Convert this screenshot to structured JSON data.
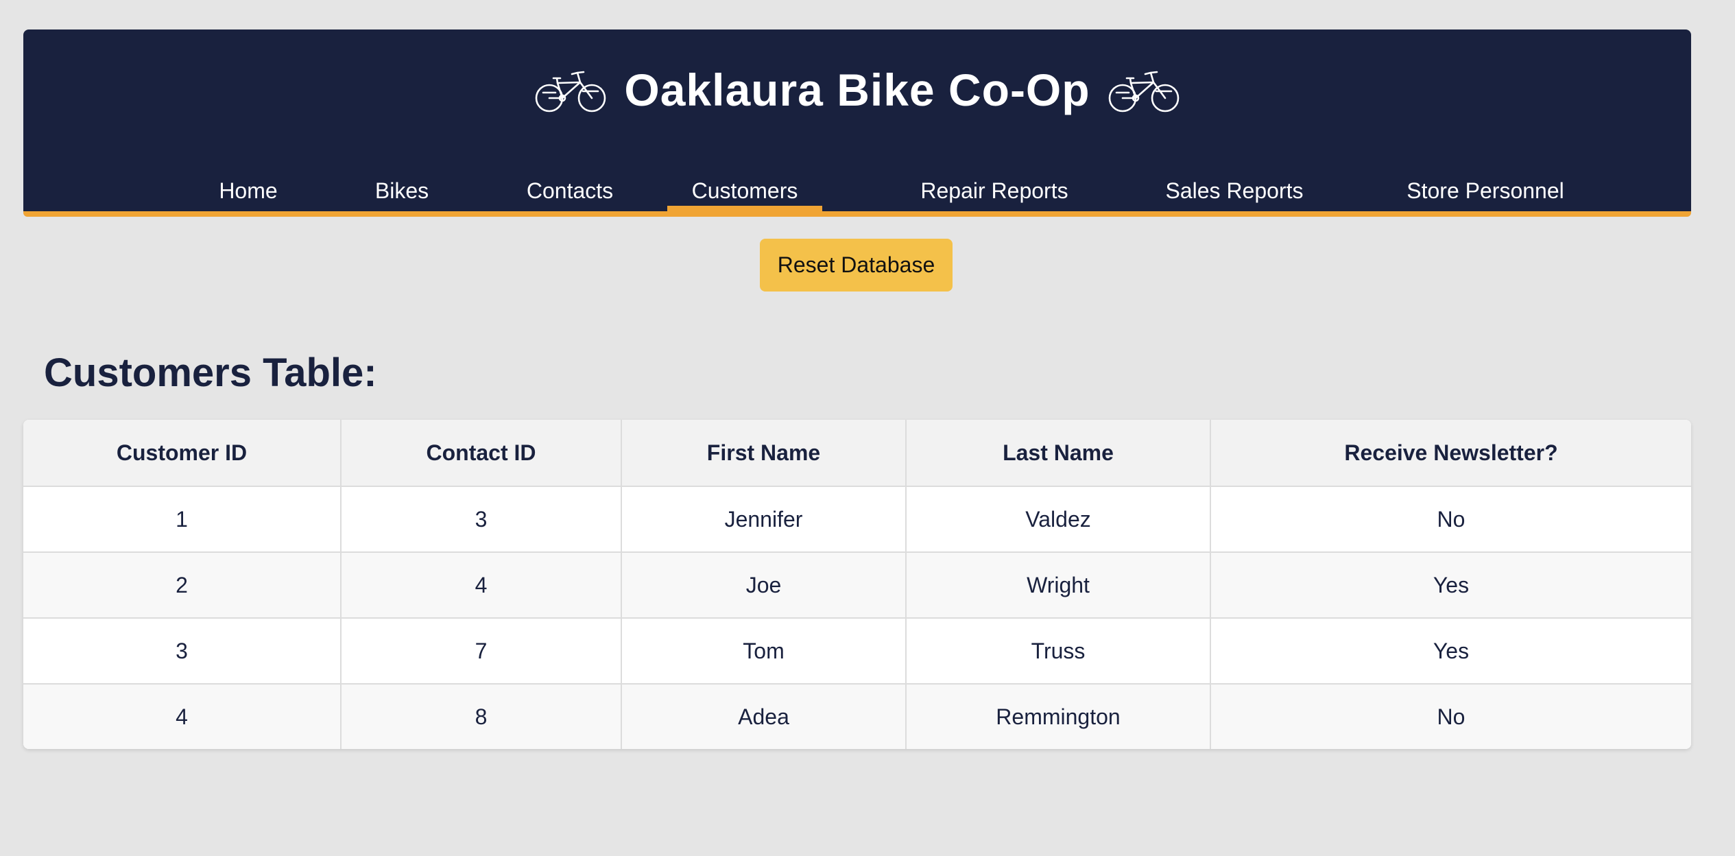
{
  "header": {
    "title": "Oaklaura Bike Co-Op",
    "icon_left": "bicycle-icon",
    "icon_right": "bicycle-icon",
    "background_color": "#19213e",
    "accent_color": "#f0a434"
  },
  "nav": {
    "items": [
      {
        "label": "Home"
      },
      {
        "label": "Bikes"
      },
      {
        "label": "Contacts"
      },
      {
        "label": "Customers",
        "active": true
      },
      {
        "label": "Repair Reports"
      },
      {
        "label": "Sales Reports"
      },
      {
        "label": "Store Personnel"
      }
    ]
  },
  "actions": {
    "reset_label": "Reset Database",
    "reset_color": "#f4c14a"
  },
  "main": {
    "section_title": "Customers Table:",
    "table": {
      "columns": [
        "Customer ID",
        "Contact ID",
        "First Name",
        "Last Name",
        "Receive Newsletter?"
      ],
      "rows": [
        [
          "1",
          "3",
          "Jennifer",
          "Valdez",
          "No"
        ],
        [
          "2",
          "4",
          "Joe",
          "Wright",
          "Yes"
        ],
        [
          "3",
          "7",
          "Tom",
          "Truss",
          "Yes"
        ],
        [
          "4",
          "8",
          "Adea",
          "Remmington",
          "No"
        ]
      ]
    }
  }
}
